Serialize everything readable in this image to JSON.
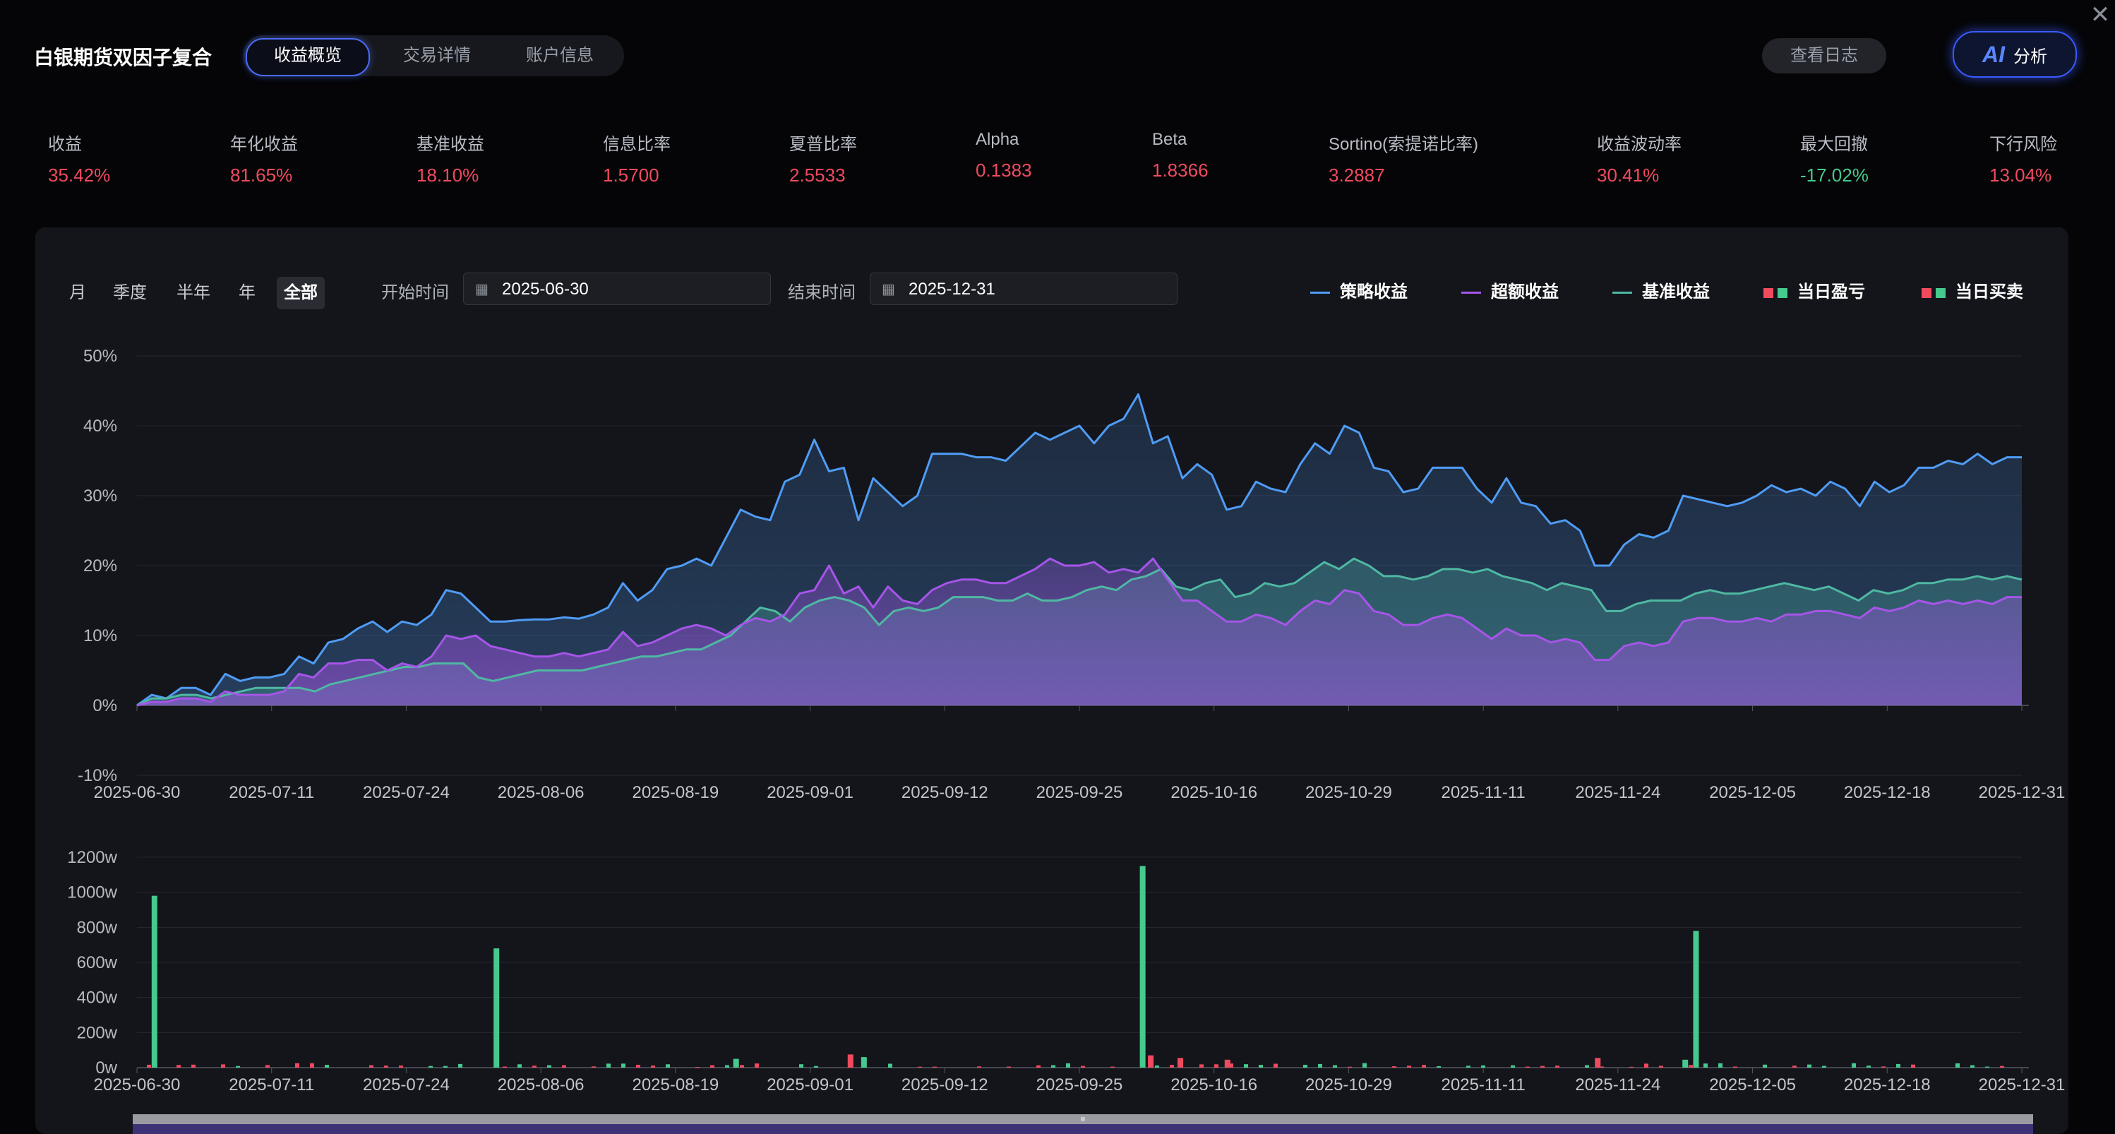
{
  "header": {
    "title": "白银期货双因子复合",
    "tabs": [
      {
        "label": "收益概览",
        "active": true
      },
      {
        "label": "交易详情",
        "active": false
      },
      {
        "label": "账户信息",
        "active": false
      }
    ],
    "log_button": "查看日志",
    "ai_button": {
      "mark": "AI",
      "label": "分析"
    }
  },
  "metrics": [
    {
      "label": "收益",
      "value": "35.42%",
      "tone": "red"
    },
    {
      "label": "年化收益",
      "value": "81.65%",
      "tone": "red"
    },
    {
      "label": "基准收益",
      "value": "18.10%",
      "tone": "red"
    },
    {
      "label": "信息比率",
      "value": "1.5700",
      "tone": "red"
    },
    {
      "label": "夏普比率",
      "value": "2.5533",
      "tone": "red"
    },
    {
      "label": "Alpha",
      "value": "0.1383",
      "tone": "red"
    },
    {
      "label": "Beta",
      "value": "1.8366",
      "tone": "red"
    },
    {
      "label": "Sortino(索提诺比率)",
      "value": "3.2887",
      "tone": "red"
    },
    {
      "label": "收益波动率",
      "value": "30.41%",
      "tone": "red"
    },
    {
      "label": "最大回撤",
      "value": "-17.02%",
      "tone": "green"
    },
    {
      "label": "下行风险",
      "value": "13.04%",
      "tone": "red"
    }
  ],
  "filters": {
    "periods": [
      {
        "label": "月",
        "active": false
      },
      {
        "label": "季度",
        "active": false
      },
      {
        "label": "半年",
        "active": false
      },
      {
        "label": "年",
        "active": false
      },
      {
        "label": "全部",
        "active": true
      }
    ],
    "start_label": "开始时间",
    "start_value": "2025-06-30",
    "end_label": "结束时间",
    "end_value": "2025-12-31"
  },
  "legend": [
    {
      "label": "策略收益",
      "kind": "line",
      "colors": [
        "#4f9cf5"
      ]
    },
    {
      "label": "超额收益",
      "kind": "line",
      "colors": [
        "#a655e8"
      ]
    },
    {
      "label": "基准收益",
      "kind": "line",
      "colors": [
        "#4fb8a3"
      ]
    },
    {
      "label": "当日盈亏",
      "kind": "bars",
      "colors": [
        "#f04a5f",
        "#46c98e"
      ]
    },
    {
      "label": "当日买卖",
      "kind": "bars",
      "colors": [
        "#f04a5f",
        "#46c98e"
      ]
    }
  ],
  "colors": {
    "strategy": "#4f9cf5",
    "excess": "#a655e8",
    "benchmark": "#4fb8a3",
    "up": "#f04a5f",
    "down": "#46c98e"
  },
  "chart_data": [
    {
      "type": "line",
      "x_tick_labels": [
        "2025-06-30",
        "2025-07-11",
        "2025-07-24",
        "2025-08-06",
        "2025-08-19",
        "2025-09-01",
        "2025-09-12",
        "2025-09-25",
        "2025-10-16",
        "2025-10-29",
        "2025-11-11",
        "2025-11-24",
        "2025-12-05",
        "2025-12-18",
        "2025-12-31"
      ],
      "y_tick_labels": [
        "50%",
        "40%",
        "30%",
        "20%",
        "10%",
        "0%",
        "-10%"
      ],
      "ylim": [
        -10,
        50
      ],
      "area_fill": true,
      "series": [
        {
          "name": "策略收益",
          "values": [
            0,
            1.5,
            1,
            2.5,
            2.5,
            1.5,
            4.5,
            3.5,
            4,
            4,
            4.5,
            7,
            6,
            9,
            9.5,
            11,
            12,
            10.5,
            12,
            11.5,
            13,
            16.5,
            16,
            14,
            12,
            12,
            12.2,
            12.3,
            12.3,
            12.6,
            12.4,
            13,
            14,
            17.5,
            15,
            16.5,
            19.5,
            20,
            21,
            20,
            24,
            28,
            27,
            26.5,
            32,
            33,
            38,
            33.5,
            34,
            26.5,
            32.5,
            30.5,
            28.5,
            30,
            36,
            36,
            36,
            35.5,
            35.5,
            35,
            37,
            39,
            38,
            39,
            40,
            37.5,
            40,
            41,
            44.5,
            37.5,
            38.5,
            32.5,
            34.5,
            33,
            28,
            28.5,
            32,
            31,
            30.5,
            34.5,
            37.5,
            36,
            40,
            39,
            34,
            33.5,
            30.5,
            31,
            34,
            34,
            34,
            31,
            29,
            32.5,
            29,
            28.5,
            26,
            26.5,
            25,
            20,
            20,
            23,
            24.5,
            24,
            25,
            30,
            29.5,
            29,
            28.5,
            29,
            30,
            31.5,
            30.5,
            31,
            30,
            32,
            31,
            28.5,
            32,
            30.5,
            31.5,
            34,
            34,
            35,
            34.5,
            36,
            34.5,
            35.5,
            35.5
          ]
        },
        {
          "name": "超额收益",
          "values": [
            0,
            0.5,
            0.5,
            1,
            1,
            0.5,
            2,
            1.5,
            1.5,
            1.5,
            2,
            4.5,
            4,
            6,
            6,
            6.5,
            6.5,
            5,
            6,
            5.5,
            7,
            10,
            9.5,
            10,
            8.5,
            8,
            7.5,
            7,
            7,
            7.5,
            7,
            7.5,
            8,
            10.5,
            8.5,
            9,
            10,
            11,
            11.5,
            11,
            10,
            11.5,
            12.5,
            12,
            13,
            16,
            16.5,
            20,
            16,
            17,
            14,
            17,
            15,
            14.5,
            16.5,
            17.5,
            18,
            18,
            17.5,
            17.5,
            18.5,
            19.5,
            21,
            20,
            20,
            20.5,
            19,
            19.5,
            19,
            21,
            18,
            15,
            15,
            13.5,
            12,
            12,
            13,
            12.5,
            11.5,
            13.5,
            15,
            14.5,
            16.5,
            16,
            13.5,
            13,
            11.5,
            11.5,
            12.5,
            13,
            12.5,
            11,
            9.5,
            11,
            10,
            10,
            9,
            9.5,
            9,
            6.5,
            6.5,
            8.5,
            9,
            8.5,
            9,
            12,
            12.5,
            12.5,
            12,
            12,
            12.5,
            12,
            13,
            13,
            13.5,
            13.5,
            13,
            12.5,
            14,
            13.5,
            14,
            15,
            14.5,
            15,
            14.5,
            15,
            14.5,
            15.5,
            15.5
          ]
        },
        {
          "name": "基准收益",
          "values": [
            0,
            1,
            1,
            1.5,
            1.5,
            1,
            1.5,
            2,
            2.5,
            2.5,
            2.5,
            2.5,
            2,
            3,
            3.5,
            4,
            4.5,
            5,
            5.5,
            5.5,
            6,
            6,
            6,
            4,
            3.5,
            4,
            4.5,
            5,
            5,
            5,
            5,
            5.5,
            6,
            6.5,
            7,
            7,
            7.5,
            8,
            8,
            9,
            10,
            12,
            14,
            13.5,
            12,
            14,
            15,
            15.5,
            15,
            14,
            11.5,
            13.5,
            14,
            13.5,
            14,
            15.5,
            15.5,
            15.5,
            15,
            15,
            16,
            15,
            15,
            15.5,
            16.5,
            17,
            16.5,
            18,
            18.5,
            19.5,
            17,
            16.5,
            17.5,
            18,
            15.5,
            16,
            17.5,
            17,
            17.5,
            19,
            20.5,
            19.5,
            21,
            20,
            18.5,
            18.5,
            18,
            18.5,
            19.5,
            19.5,
            19,
            19.5,
            18.5,
            18,
            17.5,
            16.5,
            17.5,
            17,
            16.5,
            13.5,
            13.5,
            14.5,
            15,
            15,
            15,
            16,
            16.5,
            16,
            16,
            16.5,
            17,
            17.5,
            17,
            16.5,
            17,
            16,
            15,
            16.5,
            16,
            16.5,
            17.5,
            17.5,
            18,
            18,
            18.5,
            18,
            18.5,
            18
          ]
        }
      ]
    },
    {
      "type": "bar",
      "unit": "w",
      "x_tick_labels": [
        "2025-06-30",
        "2025-07-11",
        "2025-07-24",
        "2025-08-06",
        "2025-08-19",
        "2025-09-01",
        "2025-09-12",
        "2025-09-25",
        "2025-10-16",
        "2025-10-29",
        "2025-11-11",
        "2025-11-24",
        "2025-12-05",
        "2025-12-18",
        "2025-12-31"
      ],
      "y_tick_labels": [
        "1200w",
        "1000w",
        "800w",
        "600w",
        "400w",
        "200w",
        "0w"
      ],
      "ylim": [
        0,
        1200
      ],
      "bars": [
        {
          "date_index": 0.13,
          "value": 980,
          "side": "down"
        },
        {
          "date_index": 2.67,
          "value": 680,
          "side": "down"
        },
        {
          "date_index": 7.47,
          "value": 1150,
          "side": "down"
        },
        {
          "date_index": 11.58,
          "value": 780,
          "side": "down"
        },
        {
          "date_index": 5.3,
          "value": 75,
          "side": "up"
        },
        {
          "date_index": 5.4,
          "value": 60,
          "side": "down"
        },
        {
          "date_index": 7.53,
          "value": 70,
          "side": "up"
        },
        {
          "date_index": 7.75,
          "value": 55,
          "side": "up"
        },
        {
          "date_index": 10.85,
          "value": 55,
          "side": "up"
        },
        {
          "date_index": 8.1,
          "value": 45,
          "side": "up"
        },
        {
          "date_index": 4.45,
          "value": 50,
          "side": "down"
        },
        {
          "date_index": 11.5,
          "value": 45,
          "side": "down"
        }
      ]
    }
  ]
}
